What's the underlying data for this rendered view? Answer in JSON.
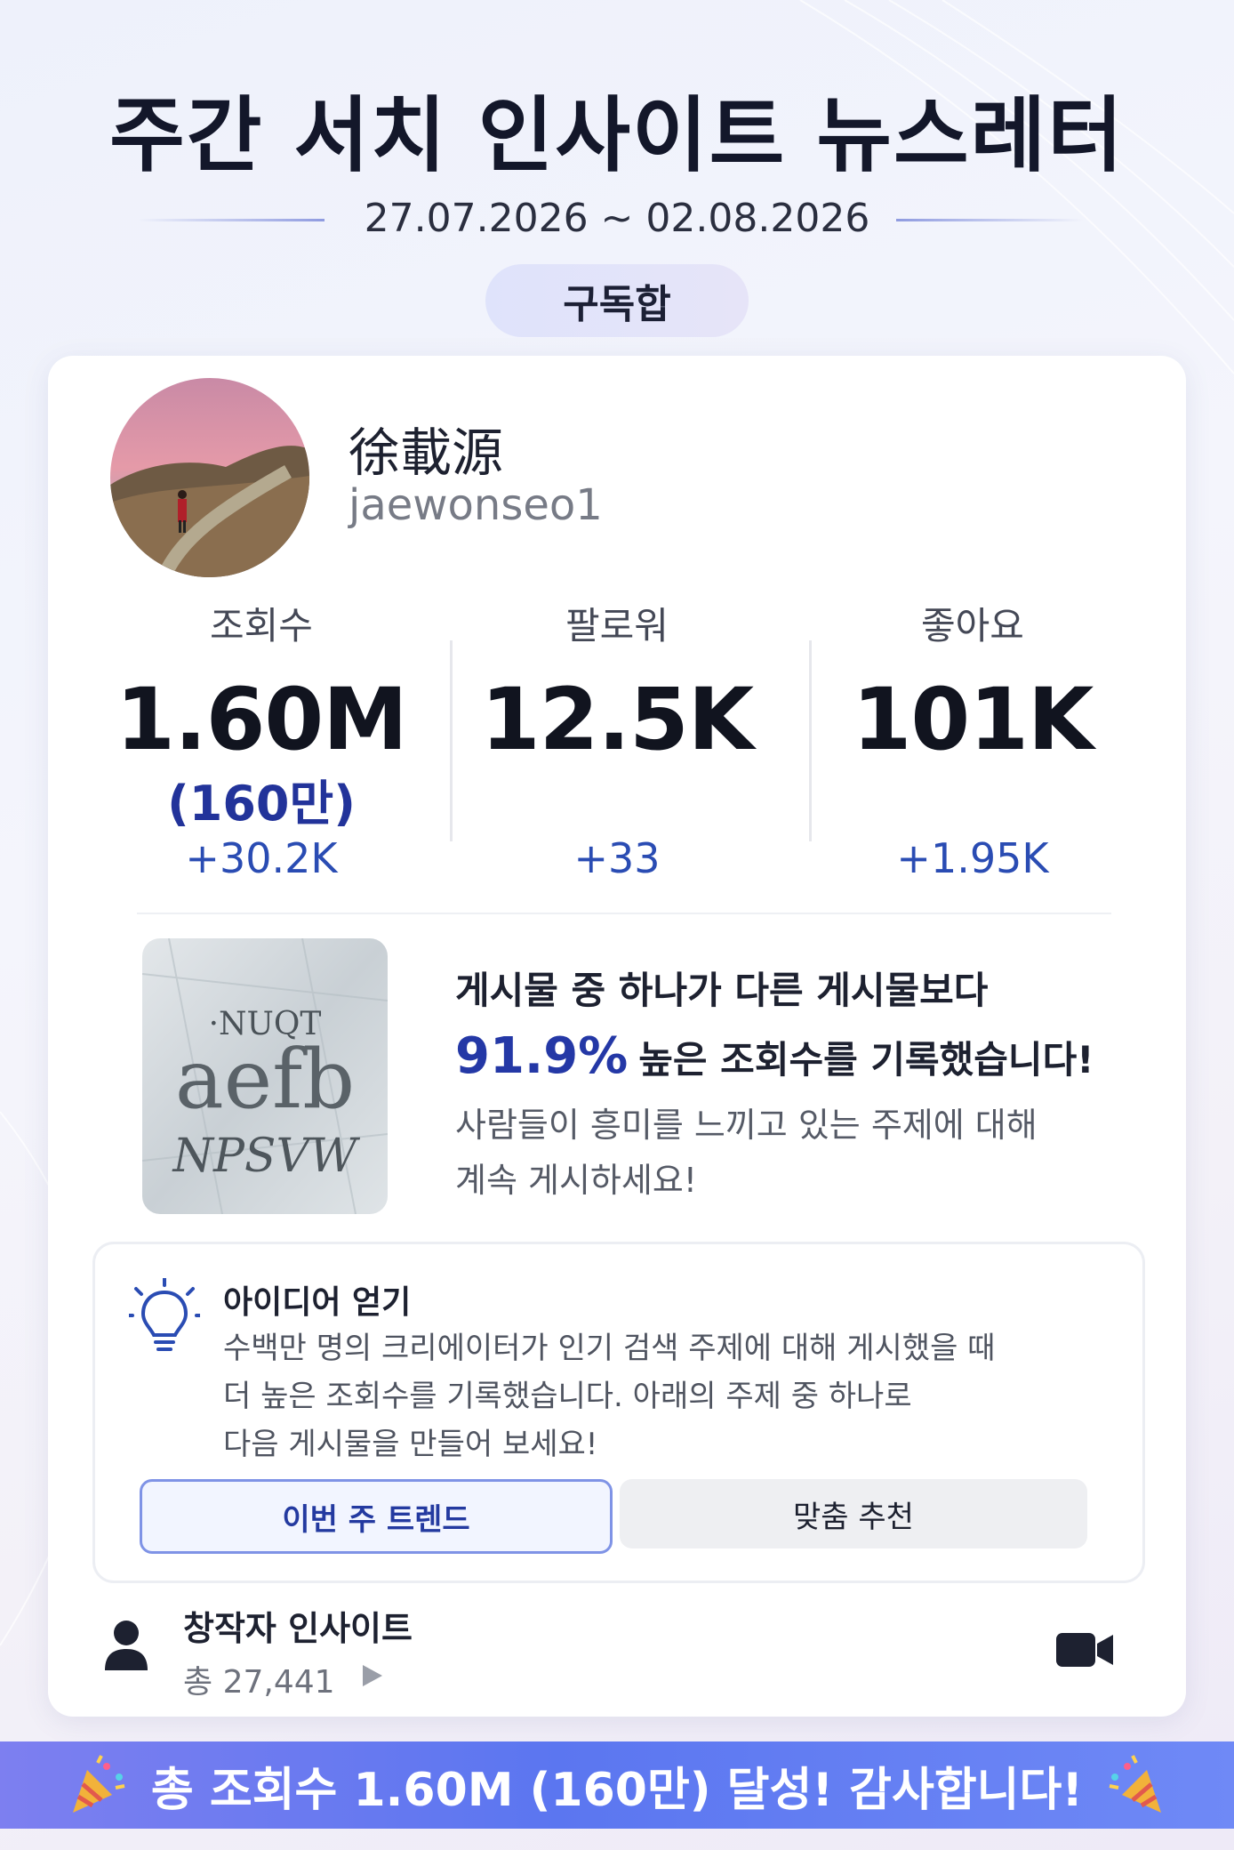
{
  "header": {
    "title": "주간 서치 인사이트 뉴스레터",
    "date_range": "27.07.2026 ~ 02.08.2026",
    "subscribe_label": "구독합"
  },
  "profile": {
    "display_name": "徐載源",
    "handle": "jaewonseo1"
  },
  "stats": [
    {
      "label": "조회수",
      "value": "1.60M",
      "value_man": "(160만)",
      "delta": "+30.2K"
    },
    {
      "label": "팔로워",
      "value": "12.5K",
      "delta": "+33"
    },
    {
      "label": "좋아요",
      "value": "101K",
      "delta": "+1.95K"
    }
  ],
  "insight": {
    "line1": "게시물 중 하나가 다른 게시물보다",
    "percent": "91.9%",
    "line2_rest": "높은 조회수를 기록했습니다!",
    "sub_line1": "사람들이 흥미를 느끼고 있는 주제에 대해",
    "sub_line2": "계속 게시하세요!",
    "thumb_text": {
      "row1": "·NUQT",
      "row2": "aefb",
      "row3": "NPSVW"
    }
  },
  "idea": {
    "title": "아이디어 얻기",
    "body_line1": "수백만 명의 크리에이터가 인기 검색 주제에 대해 게시했을 때",
    "body_line2": "더 높은 조회수를 기록했습니다. 아래의 주제 중 하나로",
    "body_line3": "다음 게시물을 만들어 보세요!",
    "trend_button": "이번 주 트렌드",
    "custom_button": "맞춤 추천"
  },
  "creator": {
    "title": "창작자 인사이트",
    "count": "총 27,441"
  },
  "banner": {
    "text": "총 조회수 1.60M (160만) 달성! 감사합니다!"
  },
  "colors": {
    "accent_blue": "#2438a6",
    "delta_blue": "#2a4cb3",
    "banner_start": "#7d7ff0",
    "banner_end": "#6f89f6"
  }
}
